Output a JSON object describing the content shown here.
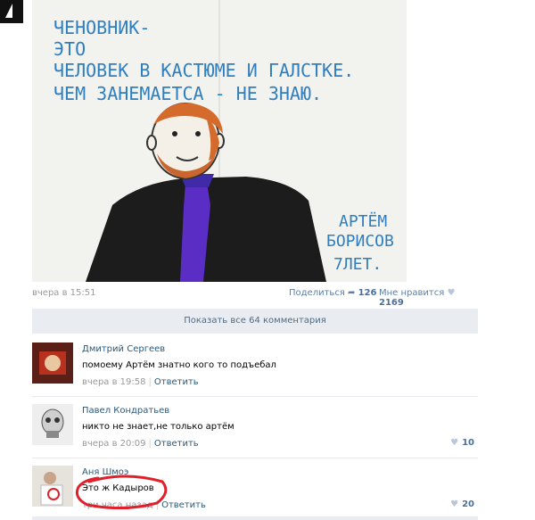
{
  "photo": {
    "text_lines": [
      "ЧЕНОВНИК-",
      "ЭТО",
      "ЧЕЛОВЕК В КАСТЮМЕ И ГАЛСТКЕ.",
      "ЧЕМ ЗАНЕМАЕТСА - НЕ ЗНАЮ."
    ],
    "signature_lines": [
      "АРТЁМ",
      "БОРИСОВ",
      "7ЛЕТ."
    ]
  },
  "post": {
    "time": "вчера в 15:51",
    "share_label": "Поделиться",
    "share_count": "126",
    "like_label": "Мне нравится",
    "like_count": "2169"
  },
  "show_all": "Показать все 64 комментария",
  "comments": [
    {
      "author": "Дмитрий Сергеев",
      "text": "помоему Артём знатно кого то подъебал",
      "time": "вчера в 19:58",
      "reply": "Ответить",
      "likes": ""
    },
    {
      "author": "Павел Кондратьев",
      "text": "никто не знает,не только артём",
      "time": "вчера в 20:09",
      "reply": "Ответить",
      "likes": "10"
    },
    {
      "author": "Аня Шмоэ",
      "text": "Это ж Кадыров",
      "time": "три часа назад",
      "reply": "Ответить",
      "likes": "20"
    }
  ],
  "colors": {
    "link": "#2b587a",
    "ink_blue": "#2f7fc0",
    "highlight": "#e0202a"
  }
}
